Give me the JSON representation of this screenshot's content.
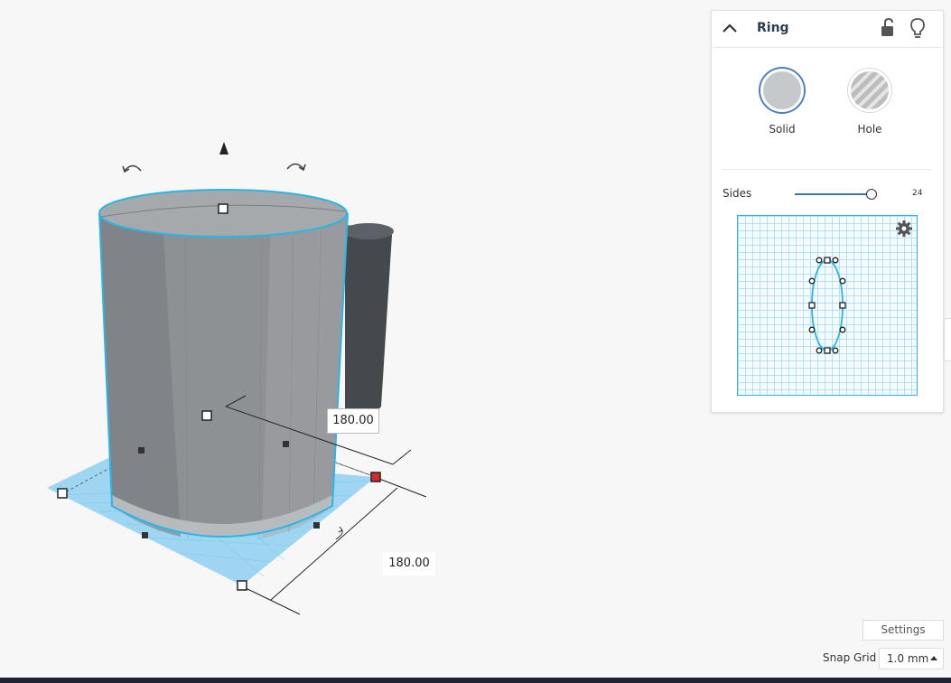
{
  "inspector": {
    "shape_name": "Ring",
    "solid_label": "Solid",
    "hole_label": "Hole",
    "sides_label": "Sides",
    "sides_value": "24",
    "sides_fraction": 0.96,
    "icons": [
      "chevron-up-icon",
      "unlock-icon",
      "lightbulb-icon",
      "gear-icon"
    ]
  },
  "viewport": {
    "width_dimension": "180.00",
    "depth_dimension": "180.00",
    "icons": [
      "rotate-left-icon",
      "rotate-right-icon",
      "lift-arrow-icon"
    ]
  },
  "footer": {
    "settings_label": "Settings",
    "snap_grid_label": "Snap Grid",
    "snap_grid_value": "1.0 mm"
  },
  "colors": {
    "selection_outline": "#29b6e6",
    "workplane": "#8ed0f0",
    "shape_body": "#8e9194",
    "accent": "#3b73b9",
    "active_handle": "#d42a2a"
  }
}
